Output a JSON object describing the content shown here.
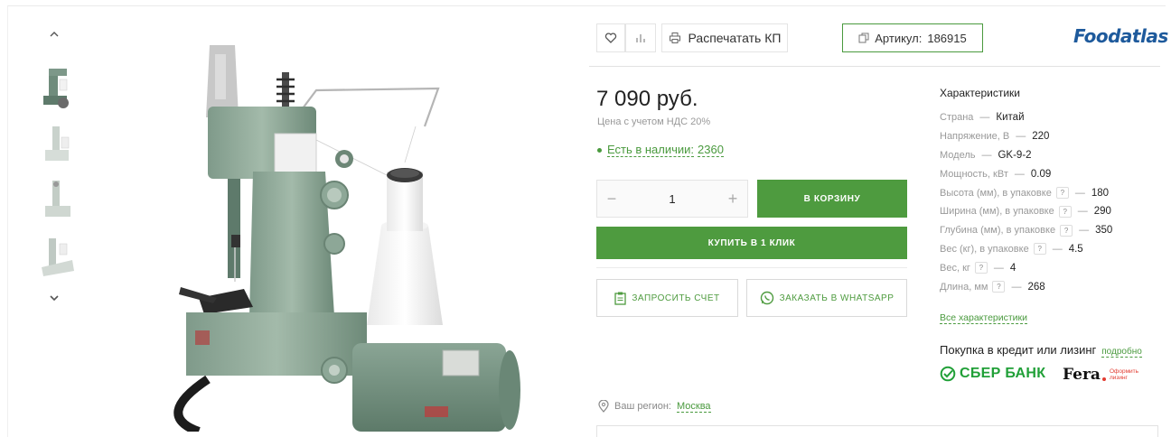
{
  "toolbar": {
    "favorite_icon": "heart-icon",
    "compare_icon": "bar-chart-icon",
    "print_label": "Распечатать КП",
    "sku_label": "Артикул:",
    "sku_value": "186915"
  },
  "brand": {
    "logo_text": "Foodatlas",
    "color": "#1e5a9c"
  },
  "product": {
    "price": "7 090 руб.",
    "vat_note": "Цена с учетом НДС 20%",
    "stock_label": "Есть в наличии:",
    "stock_count": "2360",
    "quantity": "1",
    "qty_minus": "−",
    "qty_plus": "+",
    "cart_button": "В КОРЗИНУ",
    "one_click_button": "КУПИТЬ В 1 КЛИК",
    "invoice_button": "ЗАПРОСИТЬ СЧЕТ",
    "whatsapp_button": "ЗАКАЗАТЬ В WHATSAPP",
    "accent_color": "#4e9b3f"
  },
  "region": {
    "label": "Ваш регион:",
    "city": "Москва"
  },
  "specs": {
    "title": "Характеристики",
    "items": [
      {
        "label": "Страна",
        "value": "Китай",
        "has_hint": false
      },
      {
        "label": "Напряжение, В",
        "value": "220",
        "has_hint": false
      },
      {
        "label": "Модель",
        "value": "GK-9-2",
        "has_hint": false
      },
      {
        "label": "Мощность, кВт",
        "value": "0.09",
        "has_hint": false
      },
      {
        "label": "Высота (мм), в упаковке",
        "value": "180",
        "has_hint": true
      },
      {
        "label": "Ширина (мм), в упаковке",
        "value": "290",
        "has_hint": true
      },
      {
        "label": "Глубина (мм), в упаковке",
        "value": "350",
        "has_hint": true
      },
      {
        "label": "Вес (кг), в упаковке",
        "value": "4.5",
        "has_hint": true
      },
      {
        "label": "Вес, кг",
        "value": "4",
        "has_hint": true
      },
      {
        "label": "Длина, мм",
        "value": "268",
        "has_hint": true
      }
    ],
    "separator": "—",
    "hint_mark": "?",
    "all_link": "Все характеристики"
  },
  "credit": {
    "label": "Покупка в кредит или лизинг",
    "more_link": "подробно",
    "sber_text": "СБЕР БАНК",
    "fera_text": "Fera",
    "fera_sub_1": "Оформить",
    "fera_sub_2": "лизинг"
  }
}
